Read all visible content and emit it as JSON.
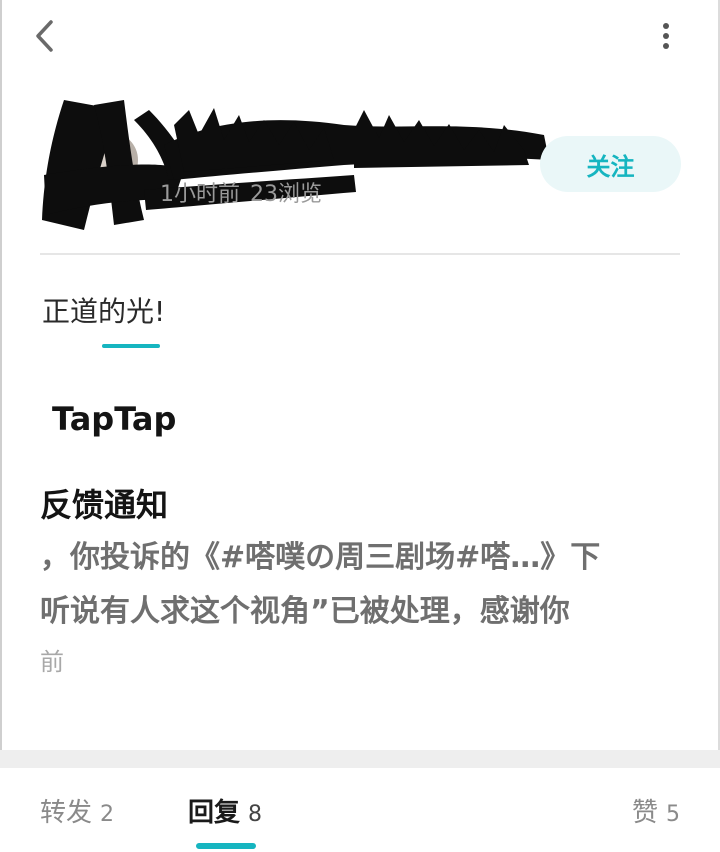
{
  "colors": {
    "accent": "#16b5c0",
    "follow_bg": "#eaf7f8",
    "muted_text": "#9a9a9a",
    "notice_text": "#6f6f6f",
    "band": "#eeeeee"
  },
  "icons": {
    "back": "chevron-left-icon",
    "more": "vertical-dots-icon"
  },
  "header": {
    "back_label": "<",
    "more_label": "⋮"
  },
  "author": {
    "time": "1小时前",
    "views": "23浏览",
    "follow_label": "关注"
  },
  "post": {
    "text": "正道的光!"
  },
  "notice": {
    "brand": "TapTap",
    "title": "反馈通知",
    "line1": "，你投诉的《#嗒噗の周三剧场#嗒…》下",
    "line2": "听说有人求这个视角”已被处理，感谢你",
    "line3": "前"
  },
  "tabs": [
    {
      "label": "转发",
      "count": "2"
    },
    {
      "label": "回复",
      "count": "8"
    },
    {
      "label": "赞",
      "count": "5"
    }
  ]
}
